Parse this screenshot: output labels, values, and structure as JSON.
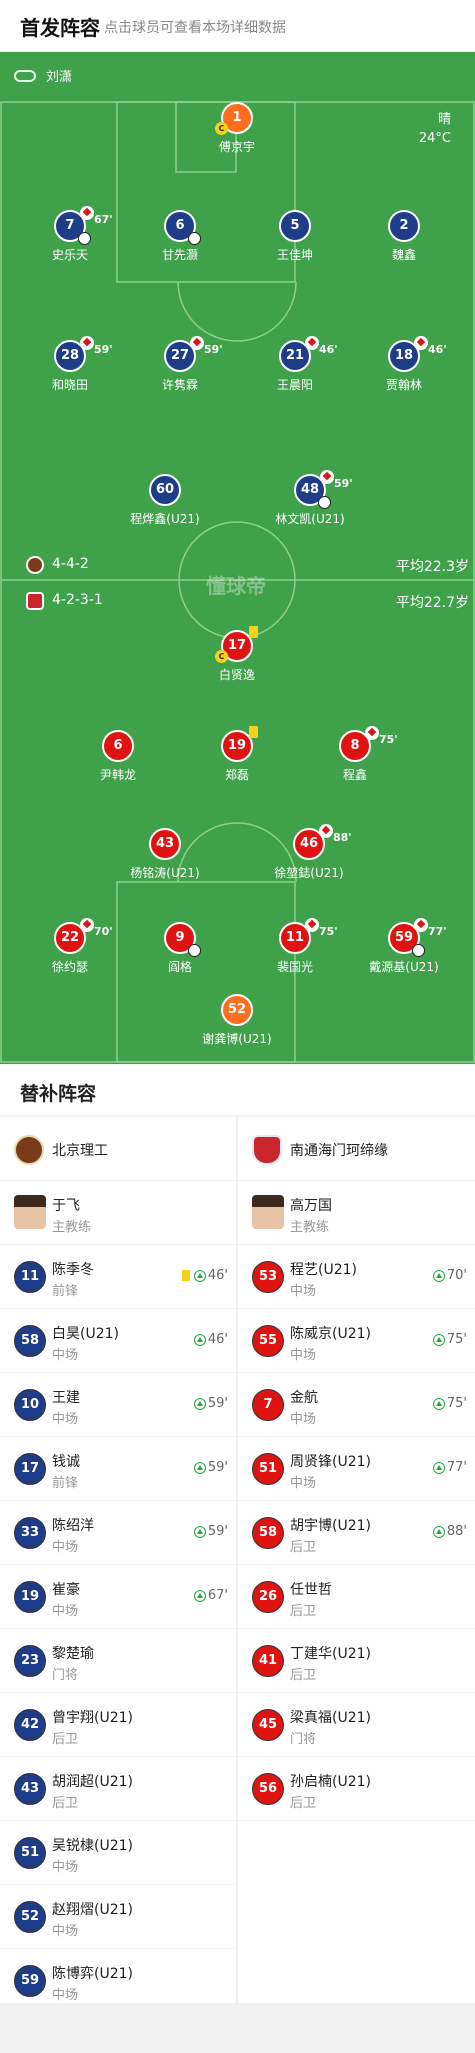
{
  "header": {
    "title": "首发阵容",
    "subtitle": "点击球员可查看本场详细数据"
  },
  "referee": "刘潇",
  "weather": {
    "condition": "晴",
    "temp": "24°C"
  },
  "watermark": "懂球帝",
  "home_team": {
    "formation": "4-4-2",
    "avg_age": "平均22.3岁"
  },
  "away_team": {
    "formation": "4-2-3-1",
    "avg_age": "平均22.7岁"
  },
  "colors": {
    "pitch": "#3fa24a",
    "home": "#1f3c88",
    "away": "#e01313",
    "gk": "#ff6d1f",
    "yellow_card": "#f4d21f",
    "sub_in": "#2aa84a"
  },
  "home_players": [
    {
      "num": "1",
      "name": "傅京宇",
      "captain": "C"
    },
    {
      "num": "7",
      "name": "史乐天",
      "sub": "67'"
    },
    {
      "num": "6",
      "name": "甘先灏"
    },
    {
      "num": "5",
      "name": "王佳坤"
    },
    {
      "num": "2",
      "name": "魏鑫"
    },
    {
      "num": "28",
      "name": "和晓田",
      "sub": "59'"
    },
    {
      "num": "27",
      "name": "许隽霖",
      "sub": "59'"
    },
    {
      "num": "21",
      "name": "王晨阳",
      "sub": "46'"
    },
    {
      "num": "18",
      "name": "贾翰林",
      "sub": "46'"
    },
    {
      "num": "60",
      "name": "程烨鑫(U21)"
    },
    {
      "num": "48",
      "name": "林文凯(U21)",
      "sub": "59'"
    }
  ],
  "away_players": [
    {
      "num": "17",
      "name": "白贤逸",
      "captain": "C"
    },
    {
      "num": "6",
      "name": "尹韩龙"
    },
    {
      "num": "19",
      "name": "郑磊"
    },
    {
      "num": "8",
      "name": "程鑫",
      "sub": "75'"
    },
    {
      "num": "43",
      "name": "杨铭涛(U21)"
    },
    {
      "num": "46",
      "name": "徐堃鋕(U21)",
      "sub": "88'"
    },
    {
      "num": "22",
      "name": "徐约瑟",
      "sub": "70'"
    },
    {
      "num": "9",
      "name": "阎格"
    },
    {
      "num": "11",
      "name": "裴国光",
      "sub": "75'"
    },
    {
      "num": "59",
      "name": "戴源基(U21)",
      "sub": "77'"
    },
    {
      "num": "52",
      "name": "谢龚博(U21)"
    }
  ],
  "subs": {
    "title": "替补阵容",
    "home": {
      "team": "北京理工",
      "coach": {
        "name": "于飞",
        "role": "主教练"
      },
      "players": [
        {
          "num": "11",
          "name": "陈季冬",
          "pos": "前锋",
          "min": "46'"
        },
        {
          "num": "58",
          "name": "白昊(U21)",
          "pos": "中场",
          "min": "46'"
        },
        {
          "num": "10",
          "name": "王建",
          "pos": "中场",
          "min": "59'"
        },
        {
          "num": "17",
          "name": "钱诚",
          "pos": "前锋",
          "min": "59'"
        },
        {
          "num": "33",
          "name": "陈绍洋",
          "pos": "中场",
          "min": "59'"
        },
        {
          "num": "19",
          "name": "崔豪",
          "pos": "中场",
          "min": "67'"
        },
        {
          "num": "23",
          "name": "黎楚瑜",
          "pos": "门将"
        },
        {
          "num": "42",
          "name": "曾宇翔(U21)",
          "pos": "后卫"
        },
        {
          "num": "43",
          "name": "胡润超(U21)",
          "pos": "后卫"
        },
        {
          "num": "51",
          "name": "吴锐棣(U21)",
          "pos": "中场"
        },
        {
          "num": "52",
          "name": "赵翔熠(U21)",
          "pos": "中场"
        },
        {
          "num": "59",
          "name": "陈博弈(U21)",
          "pos": "中场"
        }
      ]
    },
    "away": {
      "team": "南通海门珂缔缘",
      "coach": {
        "name": "高万国",
        "role": "主教练"
      },
      "players": [
        {
          "num": "53",
          "name": "程艺(U21)",
          "pos": "中场",
          "min": "70'"
        },
        {
          "num": "55",
          "name": "陈威京(U21)",
          "pos": "中场",
          "min": "75'"
        },
        {
          "num": "7",
          "name": "金航",
          "pos": "中场",
          "min": "75'"
        },
        {
          "num": "51",
          "name": "周贤锋(U21)",
          "pos": "中场",
          "min": "77'"
        },
        {
          "num": "58",
          "name": "胡宇博(U21)",
          "pos": "后卫",
          "min": "88'"
        },
        {
          "num": "26",
          "name": "任世哲",
          "pos": "后卫"
        },
        {
          "num": "41",
          "name": "丁建华(U21)",
          "pos": "后卫"
        },
        {
          "num": "45",
          "name": "梁真福(U21)",
          "pos": "门将"
        },
        {
          "num": "56",
          "name": "孙启楠(U21)",
          "pos": "后卫"
        }
      ]
    }
  }
}
